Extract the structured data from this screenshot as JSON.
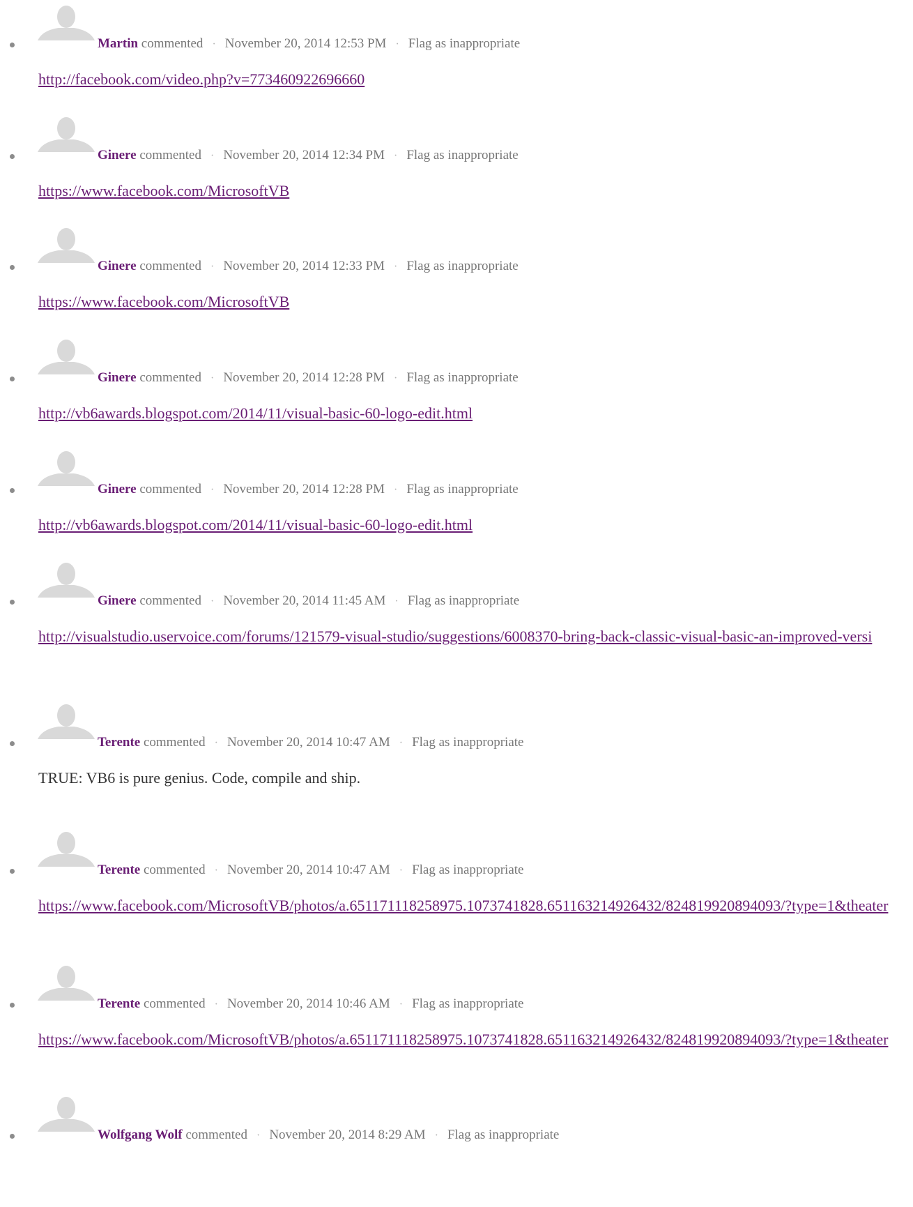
{
  "comment_verb": "commented",
  "separator": "·",
  "flag_label": "Flag as inappropriate",
  "colors": {
    "author": "#6a1e75",
    "link": "#6a1e75",
    "meta": "#777777",
    "avatar": "#d9d9d9"
  },
  "comments": [
    {
      "author": "Martin",
      "date": "November 20, 2014 12:53 PM",
      "text": "http://facebook.com/video.php?v=773460922696660",
      "is_link": true
    },
    {
      "author": "Ginere",
      "date": "November 20, 2014 12:34 PM",
      "text": "https://www.facebook.com/MicrosoftVB",
      "is_link": true
    },
    {
      "author": "Ginere",
      "date": "November 20, 2014 12:33 PM",
      "text": "https://www.facebook.com/MicrosoftVB",
      "is_link": true
    },
    {
      "author": "Ginere",
      "date": "November 20, 2014 12:28 PM",
      "text": "http://vb6awards.blogspot.com/2014/11/visual-basic-60-logo-edit.html",
      "is_link": true
    },
    {
      "author": "Ginere",
      "date": "November 20, 2014 12:28 PM",
      "text": "http://vb6awards.blogspot.com/2014/11/visual-basic-60-logo-edit.html",
      "is_link": true
    },
    {
      "author": "Ginere",
      "date": "November 20, 2014 11:45 AM",
      "text": "http://visualstudio.uservoice.com/forums/121579-visual-studio/suggestions/6008370-bring-back-classic-visual-basic-an-improved-versi",
      "is_link": true
    },
    {
      "author": "Terente",
      "date": "November 20, 2014 10:47 AM",
      "text": "TRUE: VB6 is pure genius. Code, compile and ship.",
      "is_link": false
    },
    {
      "author": "Terente",
      "date": "November 20, 2014 10:47 AM",
      "text": "https://www.facebook.com/MicrosoftVB/photos/a.651171118258975.1073741828.651163214926432/824819920894093/?type=1&theater",
      "is_link": true
    },
    {
      "author": "Terente",
      "date": "November 20, 2014 10:46 AM",
      "text": "https://www.facebook.com/MicrosoftVB/photos/a.651171118258975.1073741828.651163214926432/824819920894093/?type=1&theater",
      "is_link": true
    },
    {
      "author": "Wolfgang Wolf",
      "date": "November 20, 2014 8:29 AM",
      "text": "",
      "is_link": false
    }
  ]
}
